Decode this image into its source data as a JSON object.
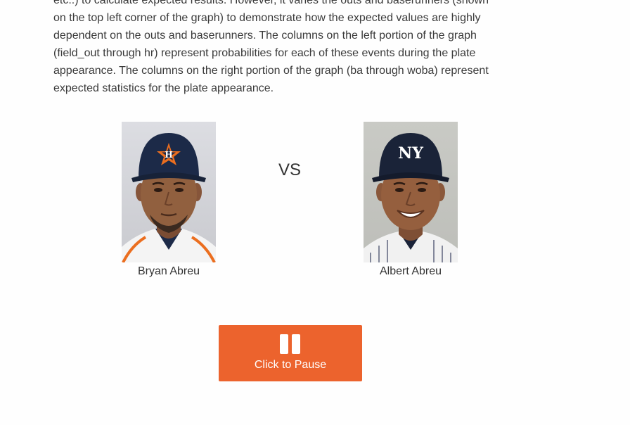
{
  "intro": {
    "lines": [
      "etc..) to calculate expected results. However, it varies the outs and baserunners (shown",
      "on the top left corner of the graph) to demonstrate how the expected values are highly",
      "dependent on the outs and baserunners. The columns on the left portion of the graph",
      "(field_out through hr) represent probabilities for each of these events during the plate",
      "appearance. The columns on the right portion of the graph (ba through woba) represent",
      "expected statistics for the plate appearance."
    ]
  },
  "matchup": {
    "left_player": {
      "name": "Bryan Abreu",
      "cap_logo": "H",
      "image": "bryan-abreu-headshot"
    },
    "vs_text": "VS",
    "right_player": {
      "name": "Albert Abreu",
      "cap_logo": "NY",
      "image": "albert-abreu-headshot"
    }
  },
  "controls": {
    "pause_button_label": "Click to Pause",
    "pause_icon": "pause-icon"
  },
  "colors": {
    "accent": "#ec632d",
    "text": "#333333",
    "astros_navy": "#1c2a48",
    "astros_orange": "#eb6e1f",
    "yankees_navy": "#1a2338"
  }
}
